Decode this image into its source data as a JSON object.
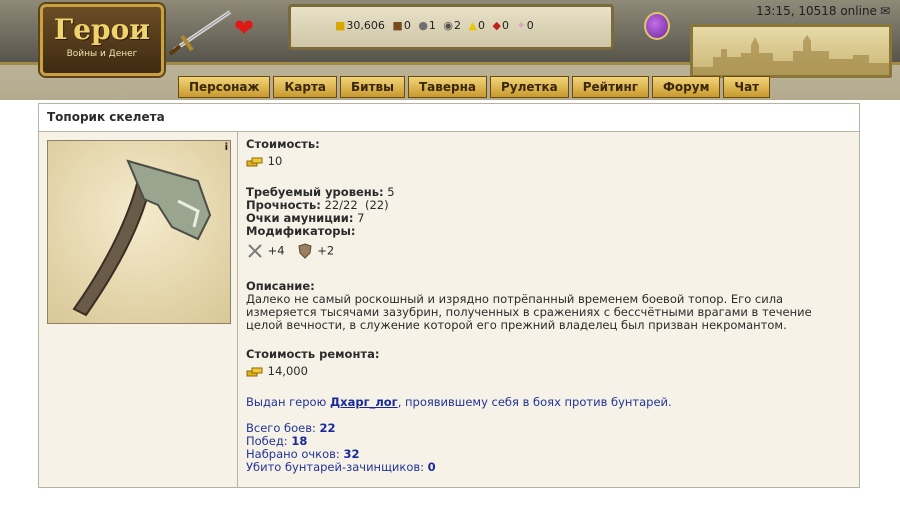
{
  "header": {
    "logo_title": "Герои",
    "logo_subtitle": "Войны и Денег",
    "resources": [
      {
        "icon": "gold-icon",
        "value": "30,606"
      },
      {
        "icon": "wood-icon",
        "value": "0"
      },
      {
        "icon": "ore-icon",
        "value": "1"
      },
      {
        "icon": "mercury-icon",
        "value": "2"
      },
      {
        "icon": "sulfur-icon",
        "value": "0"
      },
      {
        "icon": "crystal-icon",
        "value": "0"
      },
      {
        "icon": "gems-icon",
        "value": "0"
      }
    ],
    "status": "13:15, 10518 online"
  },
  "nav": {
    "tabs": [
      "Персонаж",
      "Карта",
      "Битвы",
      "Таверна",
      "Рулетка",
      "Рейтинг",
      "Форум",
      "Чат"
    ]
  },
  "item": {
    "title": "Топорик скелета",
    "cost_label": "Стоимость:",
    "cost_value": "10",
    "level_label": "Требуемый уровень:",
    "level_value": "5",
    "durability_label": "Прочность:",
    "durability_value": "22/22  (22)",
    "ammo_label": "Очки амуниции:",
    "ammo_value": "7",
    "modifiers_label": "Модификаторы:",
    "modifiers": [
      {
        "icon": "attack-icon",
        "value": "+4"
      },
      {
        "icon": "defense-icon",
        "value": "+2"
      }
    ],
    "desc_label": "Описание:",
    "desc_text": "Далеко не самый роскошный и изрядно потрёпанный временем боевой топор. Его сила измеряется тысячами зазубрин, полученных в сражениях с бессчётными врагами в течение целой вечности, в служение которой его прежний владелец был призван некромантом.",
    "repair_label": "Стоимость ремонта:",
    "repair_value": "14,000",
    "issued_prefix": "Выдан герою",
    "hero_name": "Дхарг_лог",
    "issued_suffix": ", проявившему себя в боях против бунтарей.",
    "stats": [
      {
        "label": "Всего боев:",
        "value": "22"
      },
      {
        "label": "Побед:",
        "value": "18"
      },
      {
        "label": "Набрано очков:",
        "value": "32"
      },
      {
        "label": "Убито бунтарей-зачинщиков:",
        "value": "0"
      }
    ]
  }
}
